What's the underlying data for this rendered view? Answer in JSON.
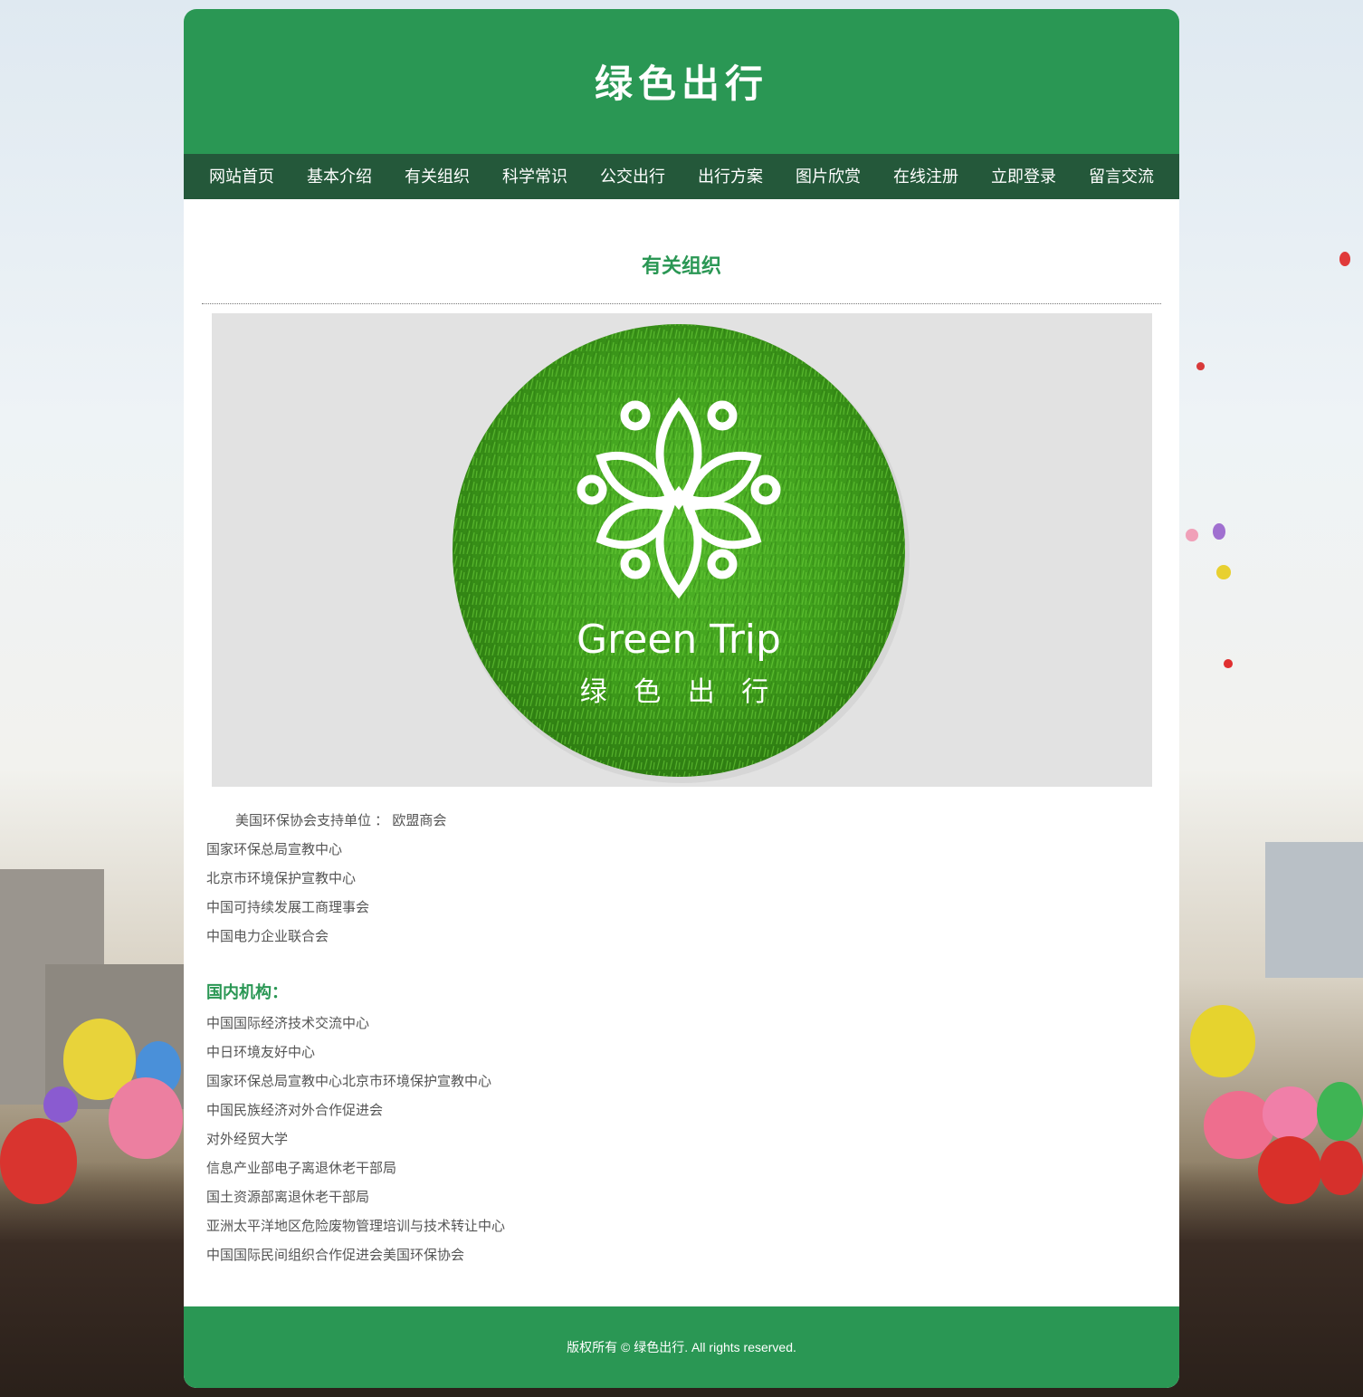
{
  "header": {
    "site_title": "绿色出行"
  },
  "nav": {
    "items": [
      "网站首页",
      "基本介绍",
      "有关组织",
      "科学常识",
      "公交出行",
      "出行方案",
      "图片欣赏",
      "在线注册",
      "立即登录",
      "留言交流"
    ]
  },
  "main": {
    "section_title": "有关组织",
    "hero": {
      "logo_text_en": "Green Trip",
      "logo_text_cn": "绿 色 出 行"
    },
    "lead": "美国环保协会支持单位 ： 欧盟商会",
    "orgs": [
      "国家环保总局宣教中心",
      "北京市环境保护宣教中心",
      "中国可持续发展工商理事会",
      "中国电力企业联合会"
    ],
    "domestic_heading": "国内机构：",
    "domestic": [
      "中国国际经济技术交流中心",
      "中日环境友好中心",
      "国家环保总局宣教中心北京市环境保护宣教中心",
      "中国民族经济对外合作促进会",
      "对外经贸大学",
      "信息产业部电子离退休老干部局",
      "国土资源部离退休老干部局",
      "亚洲太平洋地区危险废物管理培训与技术转让中心",
      "中国国际民间组织合作促进会美国环保协会"
    ]
  },
  "footer": {
    "copyright": "版权所有 © 绿色出行. All rights reserved."
  },
  "colors": {
    "primary": "#2a9754",
    "nav": "#24583a",
    "text": "#555555"
  }
}
